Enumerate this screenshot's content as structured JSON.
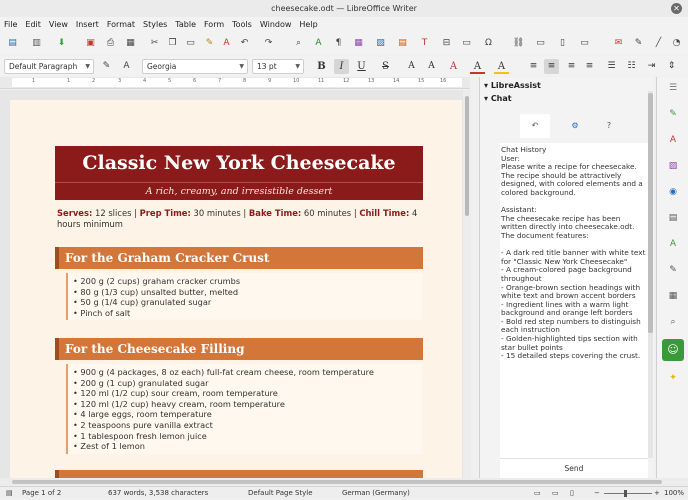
{
  "window": {
    "title": "cheesecake.odt — LibreOffice Writer",
    "close_glyph": "✕"
  },
  "menu": [
    "File",
    "Edit",
    "View",
    "Insert",
    "Format",
    "Styles",
    "Table",
    "Form",
    "Tools",
    "Window",
    "Help"
  ],
  "toolbar": {
    "paragraph_style": "Default Paragraph",
    "font_name": "Georgia",
    "font_size": "13 pt",
    "bold": "B",
    "italic": "I",
    "underline": "U",
    "strike": "S",
    "icons": [
      "new-icon",
      "templates-icon",
      "open-icon",
      "save-icon",
      "export-pdf-icon",
      "print-icon",
      "print-preview-icon",
      "cut-icon",
      "copy-icon",
      "paste-icon",
      "clone-icon",
      "clear-format-icon",
      "undo-icon",
      "redo-icon",
      "find-replace-icon",
      "spellcheck-icon",
      "formatting-marks-icon",
      "insert-table-icon",
      "insert-image-icon",
      "insert-chart-icon",
      "insert-textbox-icon",
      "page-break-icon",
      "insert-field-icon",
      "special-character-icon",
      "hyperlink-icon",
      "footnote-icon",
      "comment-icon",
      "track-changes-icon",
      "line-icon",
      "shapes-icon"
    ]
  },
  "ruler_ticks": [
    "1",
    "·",
    "1",
    "2",
    "3",
    "4",
    "5",
    "6",
    "7",
    "8",
    "9",
    "10",
    "11",
    "12",
    "13",
    "14",
    "15",
    "16",
    "17",
    "18"
  ],
  "document": {
    "title": "Classic New York Cheesecake",
    "subtitle": "A rich, creamy, and irresistible dessert",
    "meta": {
      "serves_label": "Serves:",
      "serves": "12 slices",
      "prep_label": "Prep Time:",
      "prep": "30 minutes",
      "bake_label": "Bake Time:",
      "bake": "60 minutes",
      "chill_label": "Chill Time:",
      "chill": "4 hours minimum",
      "separator": "|"
    },
    "sections": [
      {
        "heading": "For the Graham Cracker Crust",
        "items": [
          "• 200 g (2 cups) graham cracker crumbs",
          "• 80 g (1/3 cup) unsalted butter, melted",
          "• 50 g (1/4 cup) granulated sugar",
          "• Pinch of salt"
        ]
      },
      {
        "heading": "For the Cheesecake Filling",
        "items": [
          "• 900 g (4 packages, 8 oz each) full-fat cream cheese, room temperature",
          "• 200 g (1 cup) granulated sugar",
          "• 120 ml (1/2 cup) sour cream, room temperature",
          "• 120 ml (1/2 cup) heavy cream, room temperature",
          "• 4 large eggs, room temperature",
          "• 2 teaspoons pure vanilla extract",
          "• 1 tablespoon fresh lemon juice",
          "• Zest of 1 lemon"
        ]
      }
    ]
  },
  "sidebar": {
    "panel_title": "LibreAssist",
    "section_title": "Chat",
    "tabs": [
      "↶",
      "⚙",
      "?"
    ],
    "chat_text": "Chat History\nUser:\nPlease write a recipe for cheesecake. The recipe should be attractively designed, with colored elements and a colored background.\n\nAssistant:\nThe cheesecake recipe has been written directly into cheesecake.odt. The document features:\n\n- A dark red title banner with white text for \"Classic New York Cheesecake\"\n- A cream-colored page background throughout\n- Orange-brown section headings with white text and brown accent borders\n- Ingredient lines with a warm light background and orange left borders\n- Bold red step numbers to distinguish each instruction\n- Golden-highlighted tips section with star bullet points\n- 15 detailed steps covering the crust.",
    "send_label": "Send"
  },
  "deck_icons": [
    "properties-icon",
    "styles-icon",
    "gallery-icon",
    "navigator-icon",
    "page-icon",
    "style-inspector-icon",
    "manage-changes-icon",
    "design-icon",
    "libreassist-icon",
    "tips-icon"
  ],
  "status": {
    "page": "Page 1 of 2",
    "words": "637 words, 3,538 characters",
    "page_style": "Default Page Style",
    "language": "German (Germany)",
    "zoom": "100%"
  },
  "colors": {
    "banner": "#8b1a1a",
    "section": "#d2763a",
    "page_bg": "#fdf3e7",
    "accent_border": "#a04c1c"
  }
}
